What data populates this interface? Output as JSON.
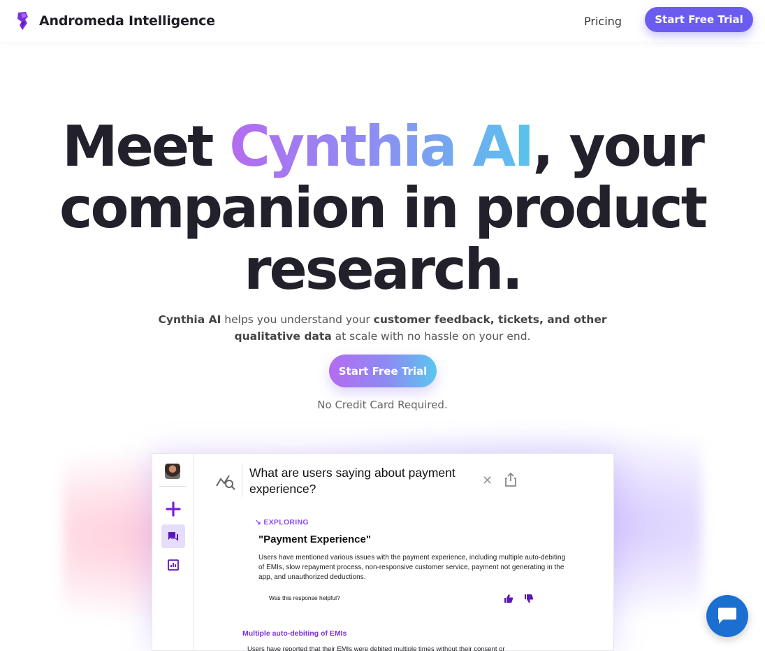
{
  "nav": {
    "brand_name": "Andromeda Intelligence",
    "logo_icon": "andromeda-logo",
    "pricing_label": "Pricing",
    "cta_label": "Start Free Trial"
  },
  "hero": {
    "title_part1": "Meet ",
    "title_highlight": "Cynthia AI",
    "title_part2": ", your companion in product research.",
    "subtitle_bold1": "Cynthia AI",
    "subtitle_text1": " helps you understand your ",
    "subtitle_bold2": "customer feedback, tickets, and other qualitative data",
    "subtitle_text2": " at scale with no hassle on your end.",
    "cta_label": "Start Free Trial",
    "note": "No Credit Card Required."
  },
  "app": {
    "question": "What are users saying about payment experience?",
    "status_label": "EXPLORING",
    "topic_title": "\"Payment Experience\"",
    "summary": "Users have mentioned various issues with the payment experience, including multiple auto-debiting of EMIs, slow repayment process, non-responsive customer service, payment not generating in the app, and unauthorized deductions.",
    "helpful_prompt": "Was this response helpful?",
    "subtopic_title": "Multiple auto-debiting of EMIs",
    "subtopic_text": "Users have reported that their EMIs were debited multiple times without their consent or"
  },
  "colors": {
    "brand_purple": "#6b5cf0",
    "gradient_start": "#b46bf0",
    "gradient_end": "#5bc6ef",
    "chat_blue": "#1a6fd0",
    "accent_violet": "#7d2fe0"
  }
}
